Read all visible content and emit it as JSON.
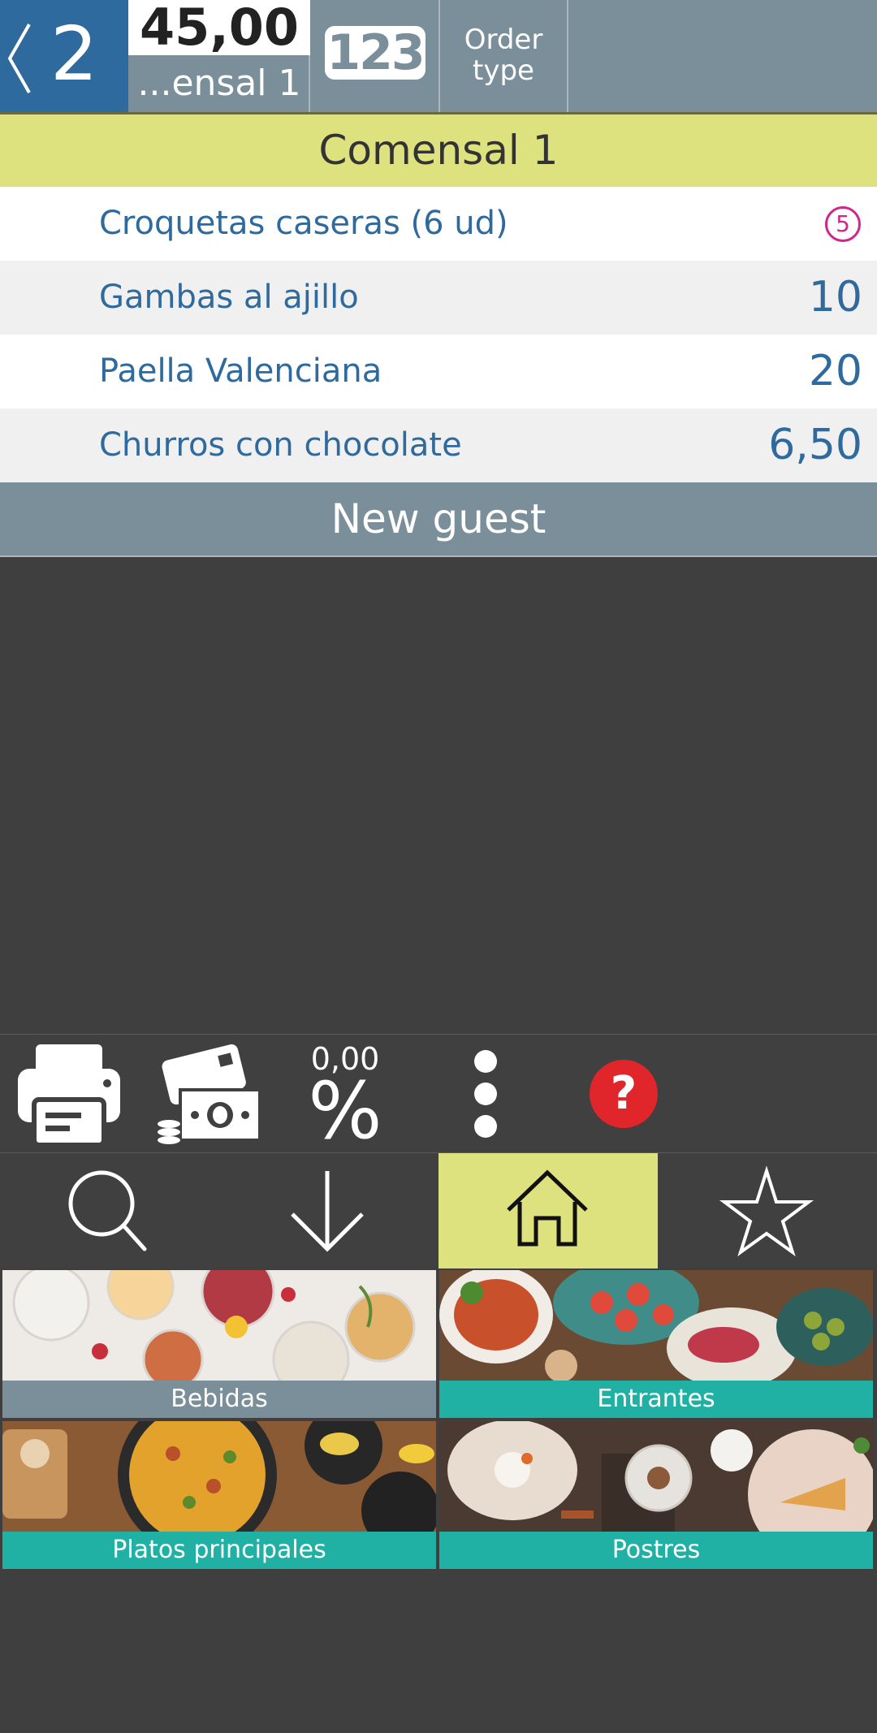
{
  "topbar": {
    "table_number": "2",
    "total": "45,00",
    "current_guest": "...ensal 1",
    "numpad_label": "123",
    "order_type_label": "Order type"
  },
  "guest": {
    "name": "Comensal 1",
    "items": [
      {
        "name": "Croquetas caseras (6 ud)",
        "price": "",
        "qty_badge": "5"
      },
      {
        "name": "Gambas al ajillo",
        "price": "10",
        "qty_badge": ""
      },
      {
        "name": "Paella Valenciana",
        "price": "20",
        "qty_badge": ""
      },
      {
        "name": "Churros con chocolate",
        "price": "6,50",
        "qty_badge": ""
      }
    ]
  },
  "new_guest_label": "New guest",
  "actions": {
    "print_icon": "printer-icon",
    "pay_icon": "cash-payment-icon",
    "discount_value": "0,00",
    "discount_symbol": "%",
    "more_icon": "more-vertical-icon",
    "help_label": "?"
  },
  "nav_tabs": [
    {
      "icon": "search-icon",
      "active": false
    },
    {
      "icon": "arrow-down-icon",
      "active": false
    },
    {
      "icon": "home-icon",
      "active": true
    },
    {
      "icon": "star-icon",
      "active": false
    }
  ],
  "categories": [
    {
      "label": "Bebidas",
      "label_color": "#7a8f99"
    },
    {
      "label": "Entrantes",
      "label_color": "#21b1a4"
    },
    {
      "label": "Platos principales",
      "label_color": "#21b1a4"
    },
    {
      "label": "Postres",
      "label_color": "#21b1a4"
    }
  ],
  "colors": {
    "primary_blue": "#2f6a9e",
    "header_slate": "#7a8f99",
    "guest_highlight": "#dde27e",
    "accent_teal": "#21b1a4",
    "help_red": "#e0262b",
    "badge_magenta": "#d0268a",
    "background_dark": "#3f3f3f"
  }
}
